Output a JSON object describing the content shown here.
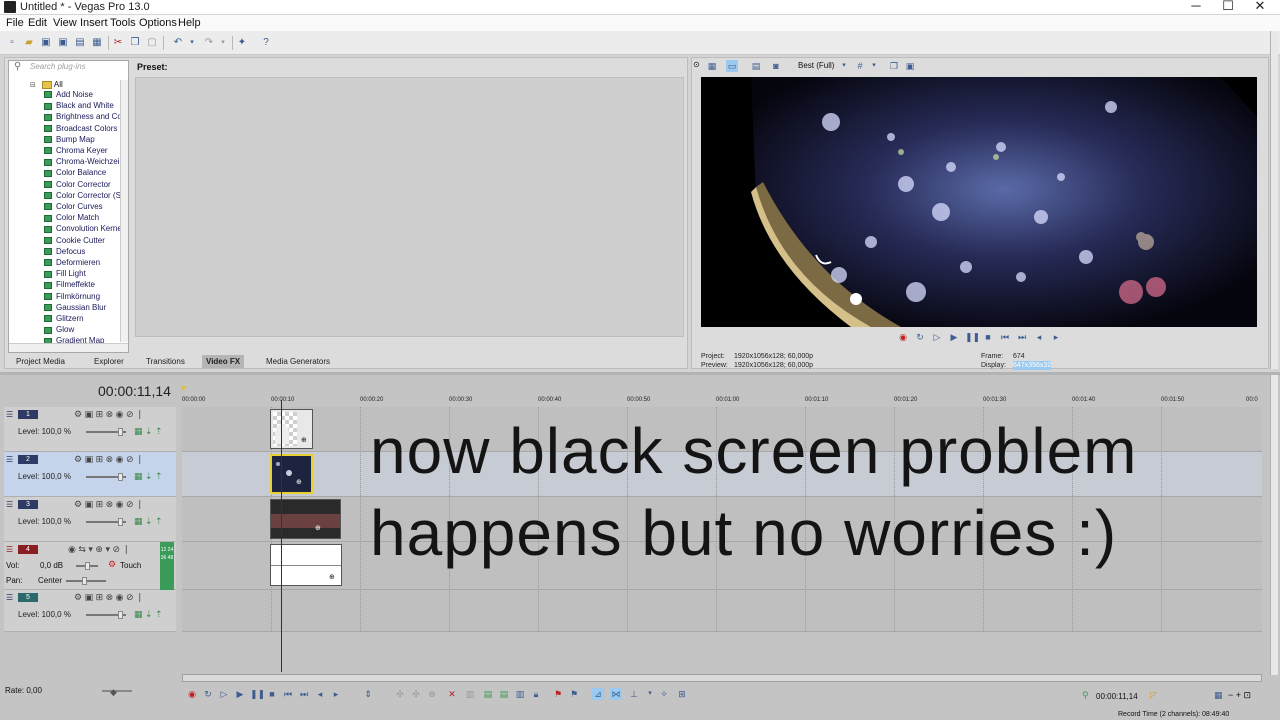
{
  "window": {
    "title": "Untitled * - Vegas Pro 13.0",
    "minimize": "─",
    "maximize": "☐",
    "close": "✕"
  },
  "menu": [
    "File",
    "Edit",
    "View",
    "Insert",
    "Tools",
    "Options",
    "Help"
  ],
  "plugins": {
    "search_placeholder": "Search plug-ins",
    "root": "All",
    "items": [
      "Add Noise",
      "Black and White",
      "Brightness and Co",
      "Broadcast Colors",
      "Bump Map",
      "Chroma Keyer",
      "Chroma-Weichzei",
      "Color Balance",
      "Color Corrector",
      "Color Corrector (S",
      "Color Curves",
      "Color Match",
      "Convolution Kerne",
      "Cookie Cutter",
      "Defocus",
      "Deformieren",
      "Fill Light",
      "Filmeffekte",
      "Filmkörnung",
      "Gaussian Blur",
      "Glitzern",
      "Glow",
      "Gradient Map"
    ],
    "preset_label": "Preset:"
  },
  "tabs": [
    "Project Media",
    "Explorer",
    "Transitions",
    "Video FX",
    "Media Generators"
  ],
  "active_tab": "Video FX",
  "preview": {
    "quality": "Best (Full)",
    "project_label": "Project:",
    "project_value": "1920x1056x128; 60,000p",
    "preview_label": "Preview:",
    "preview_value": "1920x1056x128; 60,000p",
    "frame_label": "Frame:",
    "frame_value": "674",
    "display_label": "Display:",
    "display_value": "647x356x32"
  },
  "timeline": {
    "timecode": "00:00:11,14",
    "ruler": [
      "00:00:00",
      "00:00:10",
      "00:00:20",
      "00:00:30",
      "00:00:40",
      "00:00:50",
      "00:01:00",
      "00:01:10",
      "00:01:20",
      "00:01:30",
      "00:01:40",
      "00:01:50",
      "00:0"
    ],
    "tracks": [
      {
        "num": "1",
        "level": "Level: 100,0 %"
      },
      {
        "num": "2",
        "level": "Level: 100,0 %"
      },
      {
        "num": "3",
        "level": "Level: 100,0 %"
      },
      {
        "num": "4",
        "vol": "Vol:",
        "vol_value": "0,0 dB",
        "touch": "Touch",
        "pan": "Pan:",
        "pan_value": "Center",
        "meter": "12 24 36 48"
      },
      {
        "num": "5",
        "level": "Level: 100,0 %"
      }
    ],
    "overlay_line1": "now black screen problem",
    "overlay_line2": "happens but no worries :)"
  },
  "status": {
    "rate": "Rate: 0,00",
    "time": "00:00:11,14",
    "record_time": "Record Time (2 channels): 08:49:40"
  }
}
